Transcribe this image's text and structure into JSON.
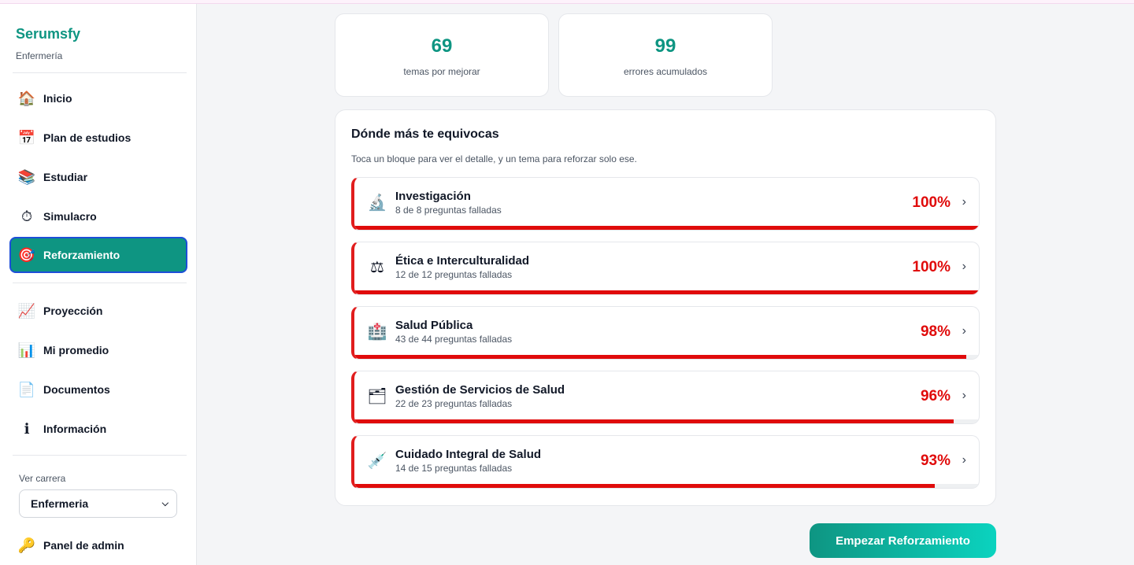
{
  "brand": {
    "title": "Serumsfy",
    "subtitle": "Enfermería"
  },
  "nav": [
    {
      "label": "Inicio",
      "icon": "🏠",
      "name": "home"
    },
    {
      "label": "Plan de estudios",
      "icon": "📅",
      "name": "calendar"
    },
    {
      "label": "Estudiar",
      "icon": "📚",
      "name": "books"
    },
    {
      "label": "Simulacro",
      "icon": "⏱",
      "name": "stopwatch"
    },
    {
      "label": "Reforzamiento",
      "icon": "🎯",
      "name": "target",
      "active": true
    },
    {
      "label": "Proyección",
      "icon": "📈",
      "name": "chart-up"
    },
    {
      "label": "Mi promedio",
      "icon": "📊",
      "name": "bar-chart"
    },
    {
      "label": "Documentos",
      "icon": "📄",
      "name": "document"
    },
    {
      "label": "Información",
      "icon": "ℹ",
      "name": "info"
    }
  ],
  "career": {
    "label": "Ver carrera",
    "selected": "Enfermeria"
  },
  "admin": {
    "label": "Panel de admin",
    "icon": "🔑"
  },
  "stats": [
    {
      "value": "69",
      "label": "temas por mejorar"
    },
    {
      "value": "99",
      "label": "errores acumulados"
    }
  ],
  "panel": {
    "title": "Dónde más te equivocas",
    "subtitle": "Toca un bloque para ver el detalle, y un tema para reforzar solo ese."
  },
  "blocks": [
    {
      "name": "Investigación",
      "detail": "8 de 8 preguntas falladas",
      "percent_label": "100%",
      "fill": 1.0,
      "icon": "🔬",
      "icon_name": "microscope"
    },
    {
      "name": "Ética e Interculturalidad",
      "detail": "12 de 12 preguntas falladas",
      "percent_label": "100%",
      "fill": 1.0,
      "icon": "⚖",
      "icon_name": "scales"
    },
    {
      "name": "Salud Pública",
      "detail": "43 de 44 preguntas falladas",
      "percent_label": "98%",
      "fill": 0.98,
      "icon": "🏥",
      "icon_name": "hospital"
    },
    {
      "name": "Gestión de Servicios de Salud",
      "detail": "22 de 23 preguntas falladas",
      "percent_label": "96%",
      "fill": 0.96,
      "icon": "🗂",
      "icon_name": "file-box"
    },
    {
      "name": "Cuidado Integral de Salud",
      "detail": "14 de 15 preguntas falladas",
      "percent_label": "93%",
      "fill": 0.93,
      "icon": "💉",
      "icon_name": "syringe"
    }
  ],
  "cta": {
    "label": "Empezar Reforzamiento"
  },
  "colors": {
    "accent": "#0e9582",
    "danger": "#e00b0b",
    "active_border": "#1d4ed8"
  }
}
